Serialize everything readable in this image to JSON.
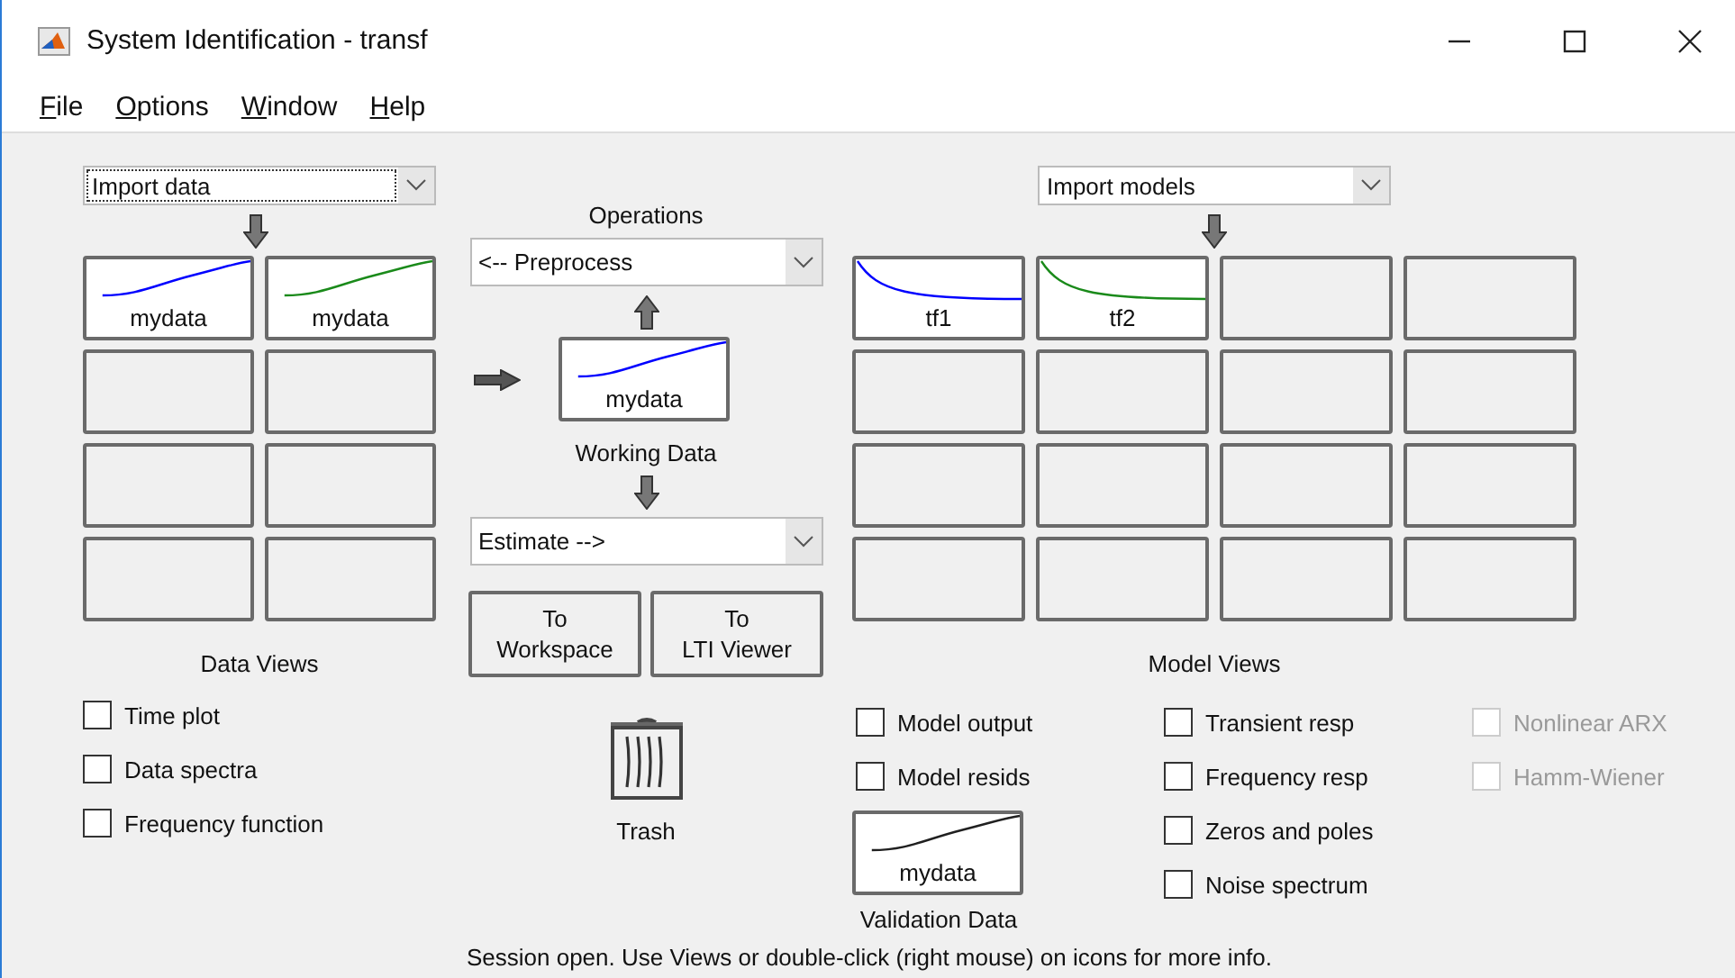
{
  "window": {
    "title": "System Identification - transf"
  },
  "menu": [
    {
      "label": "File"
    },
    {
      "label": "Options"
    },
    {
      "label": "Window"
    },
    {
      "label": "Help"
    }
  ],
  "data_panel": {
    "dropdown": {
      "value": "Import data",
      "focused": true
    },
    "tiles": [
      {
        "kind": "data",
        "label": "mydata",
        "color": "#0000ff"
      },
      {
        "kind": "data",
        "label": "mydata",
        "color": "#1a8a1a"
      },
      {
        "kind": "empty"
      },
      {
        "kind": "empty"
      },
      {
        "kind": "empty"
      },
      {
        "kind": "empty"
      },
      {
        "kind": "empty"
      },
      {
        "kind": "empty"
      }
    ],
    "title": "Data Views",
    "views": [
      {
        "label": "Time plot",
        "checked": false,
        "disabled": false
      },
      {
        "label": "Data spectra",
        "checked": false,
        "disabled": false
      },
      {
        "label": "Frequency function",
        "checked": false,
        "disabled": false
      }
    ]
  },
  "operations": {
    "title": "Operations",
    "preprocess": {
      "value": "<-- Preprocess"
    },
    "working_data": {
      "kind": "data",
      "label": "mydata",
      "color": "#0000ff"
    },
    "working_label": "Working Data",
    "estimate": {
      "value": "Estimate -->"
    },
    "buttons": [
      {
        "lines": [
          "To",
          "Workspace"
        ]
      },
      {
        "lines": [
          "To",
          "LTI Viewer"
        ]
      }
    ],
    "trash_label": "Trash"
  },
  "model_panel": {
    "dropdown": {
      "value": "Import models"
    },
    "tiles": [
      {
        "kind": "model",
        "label": "tf1",
        "color": "#0000ff"
      },
      {
        "kind": "model",
        "label": "tf2",
        "color": "#1a8a1a"
      },
      {
        "kind": "empty"
      },
      {
        "kind": "empty"
      },
      {
        "kind": "empty"
      },
      {
        "kind": "empty"
      },
      {
        "kind": "empty"
      },
      {
        "kind": "empty"
      },
      {
        "kind": "empty"
      },
      {
        "kind": "empty"
      },
      {
        "kind": "empty"
      },
      {
        "kind": "empty"
      },
      {
        "kind": "empty"
      },
      {
        "kind": "empty"
      },
      {
        "kind": "empty"
      },
      {
        "kind": "empty"
      }
    ],
    "title": "Model Views",
    "views_col1": [
      {
        "label": "Model output",
        "checked": false,
        "disabled": false
      },
      {
        "label": "Model resids",
        "checked": false,
        "disabled": false
      }
    ],
    "validation_data": {
      "kind": "data",
      "label": "mydata",
      "color": "#202020"
    },
    "validation_label": "Validation Data",
    "views_col2": [
      {
        "label": "Transient resp",
        "checked": false,
        "disabled": false
      },
      {
        "label": "Frequency resp",
        "checked": false,
        "disabled": false
      },
      {
        "label": "Zeros and poles",
        "checked": false,
        "disabled": false
      },
      {
        "label": "Noise spectrum",
        "checked": false,
        "disabled": false
      }
    ],
    "views_col3": [
      {
        "label": "Nonlinear ARX",
        "checked": false,
        "disabled": true
      },
      {
        "label": "Hamm-Wiener",
        "checked": false,
        "disabled": true
      }
    ]
  },
  "status_bar": "Session open. Use Views or double-click (right mouse) on icons for more info."
}
